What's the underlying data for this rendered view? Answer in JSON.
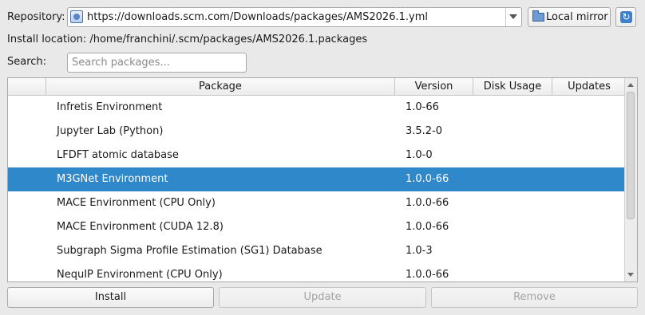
{
  "repository": {
    "label": "Repository:",
    "url": "https://downloads.scm.com/Downloads/packages/AMS2026.1.yml",
    "local_mirror_label": "Local mirror",
    "refresh_icon": "refresh-icon"
  },
  "install_location": "Install location: /home/franchini/.scm/packages/AMS2026.1.packages",
  "search": {
    "label": "Search:",
    "placeholder": "Search packages..."
  },
  "table": {
    "columns": [
      "",
      "Package",
      "Version",
      "Disk Usage",
      "Updates"
    ],
    "rows": [
      {
        "package": "Infretis Environment",
        "version": "1.0-66",
        "disk_usage": "",
        "updates": "",
        "selected": false
      },
      {
        "package": "Jupyter Lab (Python)",
        "version": "3.5.2-0",
        "disk_usage": "",
        "updates": "",
        "selected": false
      },
      {
        "package": "LFDFT atomic database",
        "version": "1.0-0",
        "disk_usage": "",
        "updates": "",
        "selected": false
      },
      {
        "package": "M3GNet Environment",
        "version": "1.0.0-66",
        "disk_usage": "",
        "updates": "",
        "selected": true
      },
      {
        "package": "MACE Environment (CPU Only)",
        "version": "1.0.0-66",
        "disk_usage": "",
        "updates": "",
        "selected": false
      },
      {
        "package": "MACE Environment (CUDA 12.8)",
        "version": "1.0.0-66",
        "disk_usage": "",
        "updates": "",
        "selected": false
      },
      {
        "package": "Subgraph Sigma Profile Estimation (SG1) Database",
        "version": "1.0-3",
        "disk_usage": "",
        "updates": "",
        "selected": false
      },
      {
        "package": "NequIP Environment (CPU Only)",
        "version": "1.0.0-66",
        "disk_usage": "",
        "updates": "",
        "selected": false
      }
    ]
  },
  "actions": {
    "install": "Install",
    "update": "Update",
    "remove": "Remove"
  },
  "colors": {
    "selection": "#2f88c9",
    "background": "#e9e9e9"
  }
}
